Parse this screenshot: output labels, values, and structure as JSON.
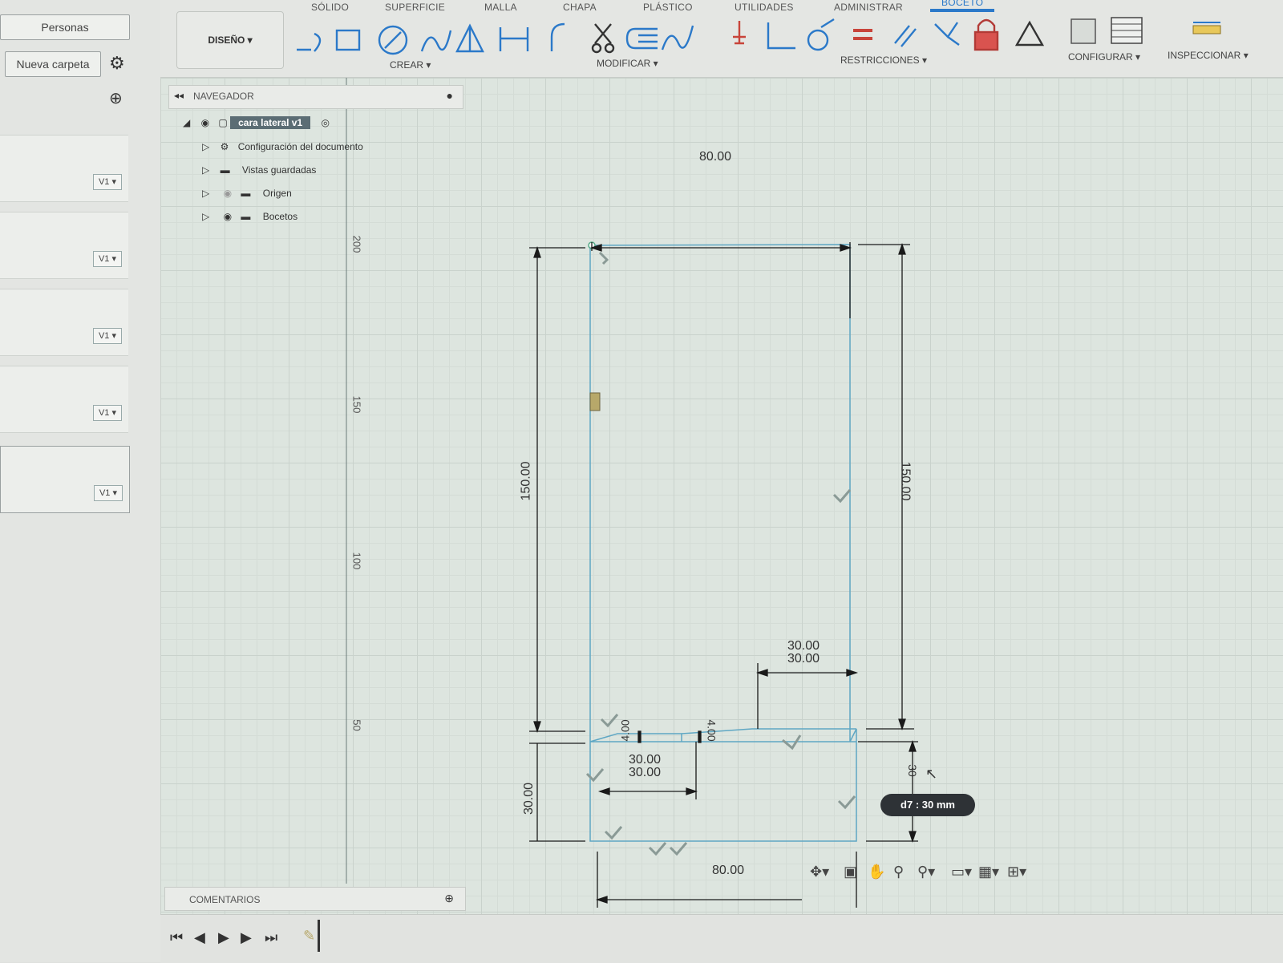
{
  "left_panel": {
    "people_button": "Personas",
    "new_folder_button": "Nueva carpeta",
    "versions": [
      "V1",
      "V1",
      "V1",
      "V1",
      "V1"
    ]
  },
  "toolbar": {
    "tabs": [
      "SÓLIDO",
      "SUPERFICIE",
      "MALLA",
      "CHAPA",
      "PLÁSTICO",
      "UTILIDADES",
      "ADMINISTRAR",
      "BOCETO"
    ],
    "active_tab": "BOCETO",
    "workspace": "DISEÑO",
    "groups": {
      "create": "CREAR",
      "modify": "MODIFICAR",
      "constraints": "RESTRICCIONES",
      "configure": "CONFIGURAR",
      "inspect": "INSPECCIONAR"
    }
  },
  "browser": {
    "title": "NAVEGADOR",
    "root": "cara lateral v1",
    "items": [
      "Configuración del documento",
      "Vistas guardadas",
      "Origen",
      "Bocetos"
    ]
  },
  "ruler": {
    "ticks": [
      "200",
      "150",
      "100",
      "50"
    ]
  },
  "sketch": {
    "dimensions": {
      "top_width": "80.00",
      "left_height": "150.00",
      "right_height": "150.00",
      "upper_small_width": "30.00",
      "upper_small_width_dup": "30.00",
      "lower_small_width": "30.00",
      "lower_small_width_dup": "30.00",
      "gap_left": "4.00",
      "gap_right": "4.00",
      "bottom_height": "30.00",
      "bottom_width": "80.00",
      "right_small": "30"
    },
    "tooltip": "d7 : 30 mm"
  },
  "comments": {
    "label": "COMENTARIOS"
  },
  "colors": {
    "accent": "#2b79c9",
    "sketch_line": "#5fa7c4",
    "dimension": "#1a1a1a",
    "grid": "#c9d2cc"
  }
}
